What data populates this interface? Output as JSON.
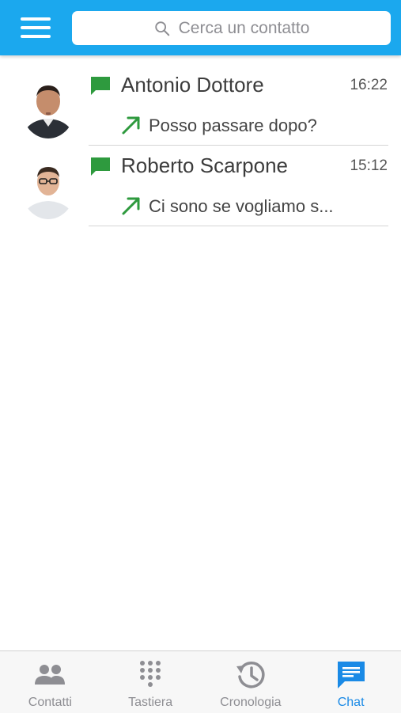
{
  "header": {
    "menu_icon": "hamburger-menu-icon",
    "search": {
      "icon": "search-icon",
      "placeholder": "Cerca un contatto"
    }
  },
  "conversations": [
    {
      "name": "Antonio Dottore",
      "time": "16:22",
      "preview": "Posso passare dopo?",
      "direction": "outgoing"
    },
    {
      "name": "Roberto Scarpone",
      "time": "15:12",
      "preview": "Ci sono se vogliamo s...",
      "direction": "outgoing"
    }
  ],
  "tabs": [
    {
      "label": "Contatti",
      "icon": "contacts-icon",
      "active": false
    },
    {
      "label": "Tastiera",
      "icon": "keypad-icon",
      "active": false
    },
    {
      "label": "Cronologia",
      "icon": "history-icon",
      "active": false
    },
    {
      "label": "Chat",
      "icon": "chat-icon",
      "active": true
    }
  ],
  "colors": {
    "header": "#1ba8ee",
    "chat_green": "#2e9a3e",
    "active_tab": "#1a8ae6",
    "inactive_tab": "#8e8e93"
  }
}
